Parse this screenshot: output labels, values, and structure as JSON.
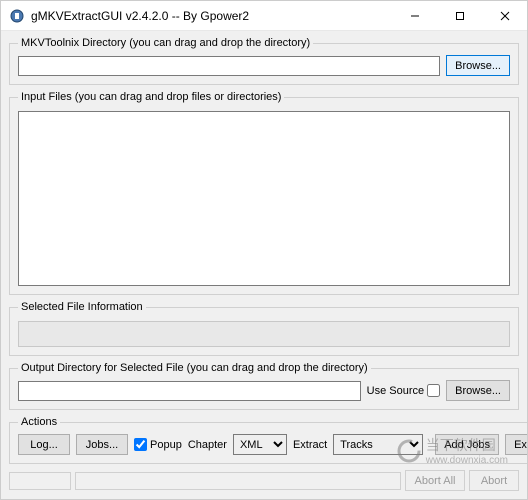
{
  "window": {
    "title": "gMKVExtractGUI v2.4.2.0  -- By Gpower2"
  },
  "toolnix": {
    "legend": "MKVToolnix Directory (you can drag and drop the directory)",
    "value": "",
    "browse_label": "Browse..."
  },
  "input_files": {
    "legend": "Input Files (you can drag and drop files or directories)"
  },
  "selected_info": {
    "legend": "Selected File Information"
  },
  "output": {
    "legend": "Output Directory for Selected File (you can drag and drop the directory)",
    "value": "",
    "use_source_label": "Use Source",
    "use_source_checked": false,
    "browse_label": "Browse..."
  },
  "actions": {
    "legend": "Actions",
    "log_label": "Log...",
    "jobs_label": "Jobs...",
    "popup_label": "Popup",
    "popup_checked": true,
    "chapter_label": "Chapter",
    "chapter_options": [
      "XML"
    ],
    "chapter_selected": "XML",
    "extract_label": "Extract",
    "extract_mode_options": [
      "Tracks"
    ],
    "extract_mode_selected": "Tracks",
    "add_jobs_label": "Add Jobs",
    "extract2_label": "Extract"
  },
  "footer": {
    "abort_all_label": "Abort All",
    "abort_label": "Abort"
  },
  "watermark": {
    "text_cn": "当下软件园",
    "text_url": "www.downxia.com"
  }
}
